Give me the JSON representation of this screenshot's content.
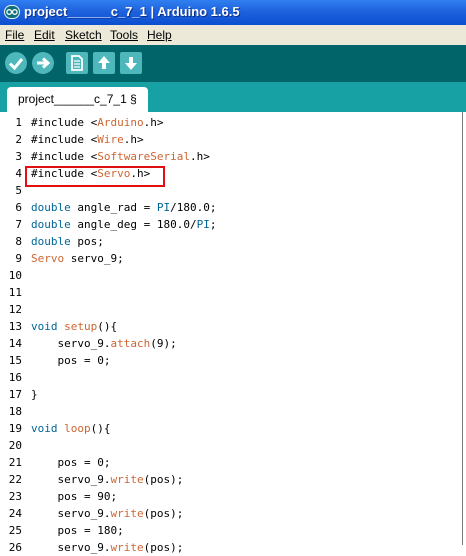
{
  "window": {
    "title": "project______c_7_1 | Arduino 1.6.5"
  },
  "menu": {
    "items": [
      "File",
      "Edit",
      "Sketch",
      "Tools",
      "Help"
    ]
  },
  "toolbar": {
    "buttons": [
      "verify-icon",
      "upload-icon",
      "new-icon",
      "open-icon",
      "save-icon"
    ]
  },
  "tabs": [
    {
      "label": "project______c_7_1 §"
    }
  ],
  "colors": {
    "toolbar_bg": "#006468",
    "tabstrip_bg": "#17a1a5",
    "highlight_border": "#e01010"
  },
  "editor": {
    "highlighted_line": 4,
    "lines": [
      {
        "n": "1",
        "parts": [
          [
            "t",
            "#include <"
          ],
          [
            "o",
            "Arduino"
          ],
          [
            "t",
            ".h>"
          ]
        ]
      },
      {
        "n": "2",
        "parts": [
          [
            "t",
            "#include <"
          ],
          [
            "o",
            "Wire"
          ],
          [
            "t",
            ".h>"
          ]
        ]
      },
      {
        "n": "3",
        "parts": [
          [
            "t",
            "#include <"
          ],
          [
            "o",
            "SoftwareSerial"
          ],
          [
            "t",
            ".h>"
          ]
        ]
      },
      {
        "n": "4",
        "parts": [
          [
            "t",
            "#include <"
          ],
          [
            "o",
            "Servo"
          ],
          [
            "t",
            ".h>"
          ]
        ]
      },
      {
        "n": "5",
        "parts": []
      },
      {
        "n": "6",
        "parts": [
          [
            "b",
            "double"
          ],
          [
            "t",
            " angle_rad = "
          ],
          [
            "b",
            "PI"
          ],
          [
            "t",
            "/180.0;"
          ]
        ]
      },
      {
        "n": "7",
        "parts": [
          [
            "b",
            "double"
          ],
          [
            "t",
            " angle_deg = 180.0/"
          ],
          [
            "b",
            "PI"
          ],
          [
            "t",
            ";"
          ]
        ]
      },
      {
        "n": "8",
        "parts": [
          [
            "b",
            "double"
          ],
          [
            "t",
            " pos;"
          ]
        ]
      },
      {
        "n": "9",
        "parts": [
          [
            "o",
            "Servo"
          ],
          [
            "t",
            " servo_9;"
          ]
        ]
      },
      {
        "n": "10",
        "parts": []
      },
      {
        "n": "11",
        "parts": []
      },
      {
        "n": "12",
        "parts": []
      },
      {
        "n": "13",
        "parts": [
          [
            "b",
            "void"
          ],
          [
            "t",
            " "
          ],
          [
            "o",
            "setup"
          ],
          [
            "t",
            "(){"
          ]
        ]
      },
      {
        "n": "14",
        "parts": [
          [
            "t",
            "    servo_9."
          ],
          [
            "o",
            "attach"
          ],
          [
            "t",
            "(9);"
          ]
        ]
      },
      {
        "n": "15",
        "parts": [
          [
            "t",
            "    pos = 0;"
          ]
        ]
      },
      {
        "n": "16",
        "parts": []
      },
      {
        "n": "17",
        "parts": [
          [
            "t",
            "}"
          ]
        ]
      },
      {
        "n": "18",
        "parts": []
      },
      {
        "n": "19",
        "parts": [
          [
            "b",
            "void"
          ],
          [
            "t",
            " "
          ],
          [
            "o",
            "loop"
          ],
          [
            "t",
            "(){"
          ]
        ]
      },
      {
        "n": "20",
        "parts": []
      },
      {
        "n": "21",
        "parts": [
          [
            "t",
            "    pos = 0;"
          ]
        ]
      },
      {
        "n": "22",
        "parts": [
          [
            "t",
            "    servo_9."
          ],
          [
            "o",
            "write"
          ],
          [
            "t",
            "(pos);"
          ]
        ]
      },
      {
        "n": "23",
        "parts": [
          [
            "t",
            "    pos = 90;"
          ]
        ]
      },
      {
        "n": "24",
        "parts": [
          [
            "t",
            "    servo_9."
          ],
          [
            "o",
            "write"
          ],
          [
            "t",
            "(pos);"
          ]
        ]
      },
      {
        "n": "25",
        "parts": [
          [
            "t",
            "    pos = 180;"
          ]
        ]
      },
      {
        "n": "26",
        "parts": [
          [
            "t",
            "    servo_9."
          ],
          [
            "o",
            "write"
          ],
          [
            "t",
            "(pos);"
          ]
        ]
      }
    ]
  }
}
